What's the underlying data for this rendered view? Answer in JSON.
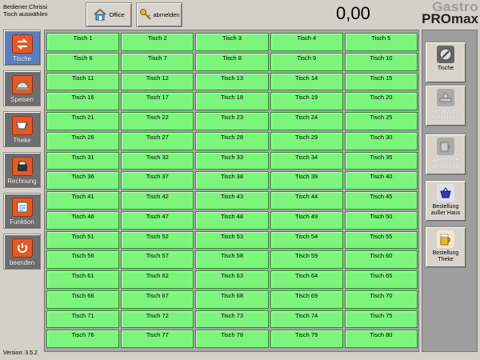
{
  "header": {
    "operator": "Bediener:Chrissi",
    "instruction": "Tisch auswählen",
    "office_label": "Office",
    "logout_label": "abmelden",
    "total": "0,00",
    "logo_line1": "Gastro",
    "logo_line2": "PROmax"
  },
  "nav": [
    {
      "label": "Tische",
      "icon": "tables-icon"
    },
    {
      "label": "Speisen",
      "icon": "cloche-icon"
    },
    {
      "label": "Theke",
      "icon": "coffee-cup-icon"
    },
    {
      "label": "Rechnung",
      "icon": "cash-register-icon"
    },
    {
      "label": "Funktion",
      "icon": "notepad-icon"
    },
    {
      "label": "beenden",
      "icon": "power-icon"
    }
  ],
  "tables": [
    "Tisch 1",
    "Tisch 2",
    "Tisch 3",
    "Tisch 4",
    "Tisch 5",
    "Tisch 6",
    "Tisch 7",
    "Tisch 8",
    "Tisch 9",
    "Tisch 10",
    "Tisch 11",
    "Tisch 12",
    "Tisch 13",
    "Tisch 14",
    "Tisch 15",
    "Tisch 16",
    "Tisch 17",
    "Tisch 18",
    "Tisch 19",
    "Tisch 20",
    "Tisch 21",
    "Tisch 22",
    "Tisch 23",
    "Tisch 24",
    "Tisch 25",
    "Tisch 26",
    "Tisch 27",
    "Tisch 28",
    "Tisch 29",
    "Tisch 30",
    "Tisch 31",
    "Tisch 32",
    "Tisch 33",
    "Tisch 34",
    "Tisch 35",
    "Tisch 36",
    "Tisch 37",
    "Tisch 38",
    "Tisch 39",
    "Tisch 40",
    "Tisch 41",
    "Tisch 42",
    "Tisch 43",
    "Tisch 44",
    "Tisch 45",
    "Tisch 46",
    "Tisch 47",
    "Tisch 48",
    "Tisch 49",
    "Tisch 50",
    "Tisch 51",
    "Tisch 52",
    "Tisch 53",
    "Tisch 54",
    "Tisch 55",
    "Tisch 56",
    "Tisch 57",
    "Tisch 58",
    "Tisch 59",
    "Tisch 60",
    "Tisch 61",
    "Tisch 62",
    "Tisch 63",
    "Tisch 64",
    "Tisch 65",
    "Tisch 66",
    "Tisch 67",
    "Tisch 68",
    "Tisch 69",
    "Tisch 70",
    "Tisch 71",
    "Tisch 72",
    "Tisch 73",
    "Tisch 74",
    "Tisch 75",
    "Tisch 76",
    "Tisch 77",
    "Tisch 78",
    "Tisch 79",
    "Tisch 80"
  ],
  "right": {
    "tische_label": "Tische",
    "alle_ausser_haus_label": "Alle Bestell. außer Haus",
    "alle_theke_label": "Alle Theke Bestellung",
    "ausser_haus_label": "Bestellung außer Haus",
    "theke_label": "Bestellung Theke"
  },
  "version": "Version: 3.5.2",
  "colors": {
    "tile": "#7df57d",
    "tile_border": "#2d8a2d",
    "active_nav": "#5a7fc0",
    "background": "#d4d0c8"
  }
}
